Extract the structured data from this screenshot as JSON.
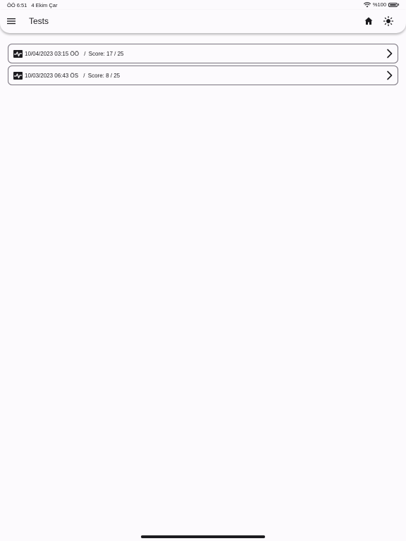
{
  "status_bar": {
    "time": "ÖÖ 6:51",
    "date": "4 Ekim Çar",
    "battery": "%100"
  },
  "app_bar": {
    "title": "Tests"
  },
  "tests": [
    {
      "date": "10/04/2023 03:15 ÖÖ",
      "separator": "/",
      "score": "Score: 17 / 25"
    },
    {
      "date": "10/03/2023 06:43 ÖS",
      "separator": "/",
      "score": "Score: 8 / 25"
    }
  ],
  "colors": {
    "background": "#fcfafd",
    "text": "#1c1b1f",
    "outline": "#79747e"
  }
}
